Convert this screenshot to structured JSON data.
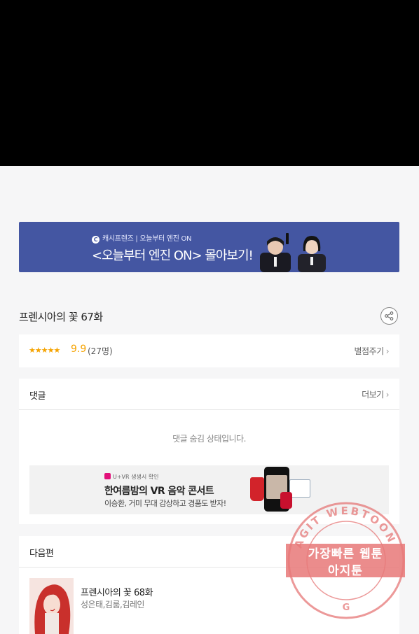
{
  "banner": {
    "brand": "캐시프렌즈 | 오늘부터 엔진 ON",
    "headline": "<오늘부터 엔진 ON> 몰아보기!"
  },
  "episode": {
    "title": "프렌시아의 꽃 67화",
    "stars": "★★★★★",
    "score": "9.9",
    "count": "(27명)",
    "rate_link": "별점주기"
  },
  "comments": {
    "heading": "댓글",
    "more": "더보기",
    "hidden_message": "댓글 숨김 상태입니다."
  },
  "ad": {
    "tag": "U+VR 생생시 확인",
    "title": "한여름밤의 VR 음악 콘서트",
    "subtitle": "이승환, 거미 무대 감상하고 경품도 받자!"
  },
  "next": {
    "heading": "다음편",
    "title": "프렌시아의 꽃 68화",
    "authors": "성은태,김룸,김레인"
  },
  "watermark": {
    "ring_text": "AGIT WEBTOON",
    "line1": "가장빠른 웹툰",
    "line2": "아지툰"
  },
  "colors": {
    "banner_bg": "#4456a2",
    "star": "#f5a300",
    "watermark": "#e57373"
  }
}
